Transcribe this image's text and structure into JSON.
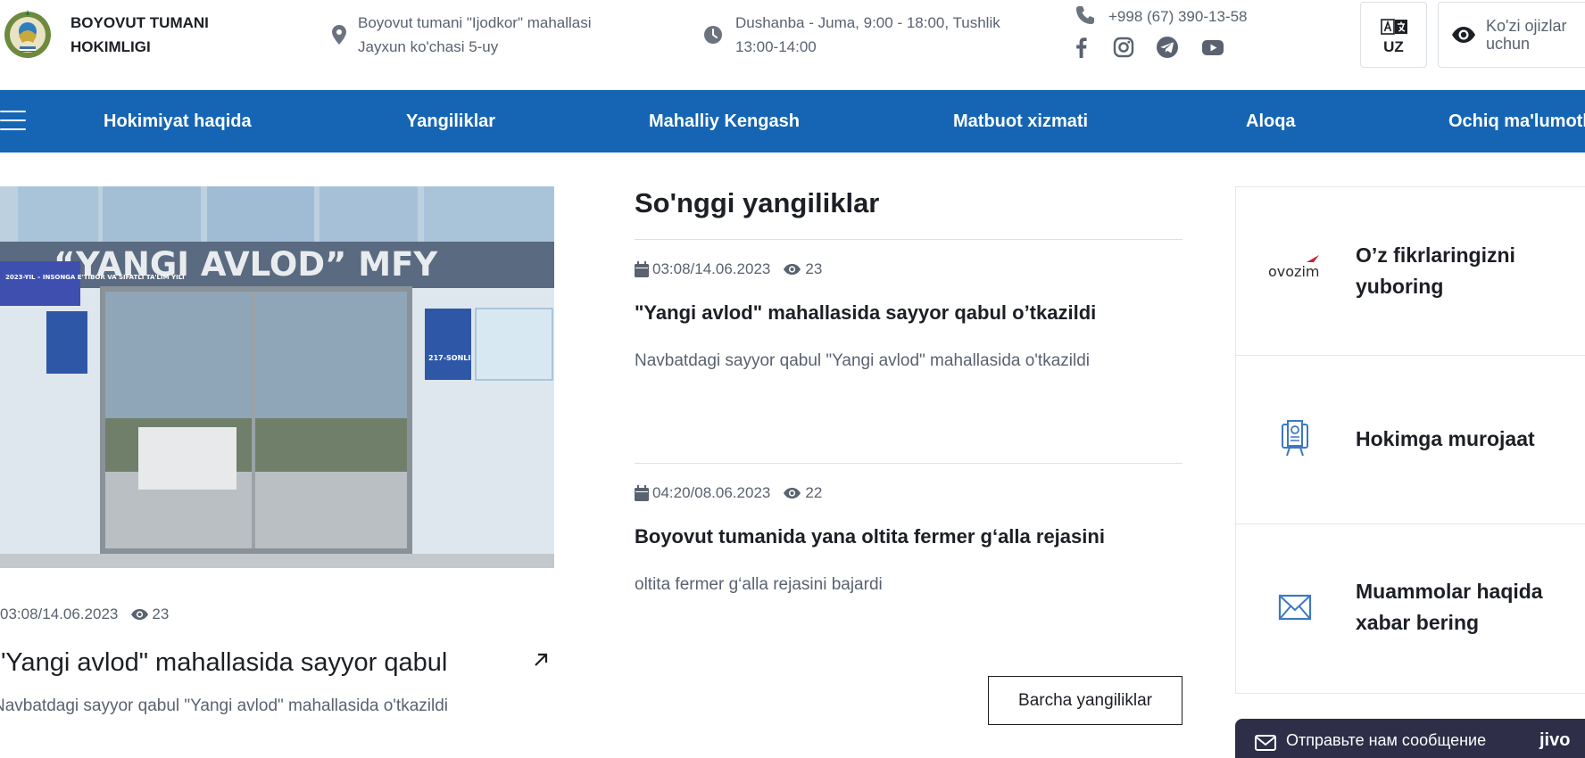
{
  "header": {
    "org_name": "BOYOVUT TUMANI HOKIMLIGI",
    "address": "Boyovut tumani \"Ijodkor\" mahallasi Jayxun ko'chasi 5-uy",
    "hours": "Dushanba - Juma, 9:00 - 18:00, Tushlik 13:00-14:00",
    "phone": "+998 (67) 390-13-58",
    "social_icons": [
      "facebook-icon",
      "instagram-icon",
      "telegram-icon",
      "youtube-icon"
    ],
    "language_label": "UZ",
    "accessibility_label": "Ko'zi ojizlar uchun"
  },
  "nav": {
    "items": [
      {
        "label": "Hokimiyat haqida"
      },
      {
        "label": "Yangiliklar"
      },
      {
        "label": "Mahalliy Kengash"
      },
      {
        "label": "Matbuot xizmati"
      },
      {
        "label": "Aloqa"
      },
      {
        "label": "Ochiq ma'lumotlar"
      }
    ]
  },
  "featured": {
    "image": {
      "sign_text": "“YANGI AVLOD” MFY",
      "banner_text": "2023-YIL – INSONGA E'TIBOR VA SIFATLI TA'LIM YILI",
      "plaque_text": "217-SONLI"
    },
    "date": "03:08/14.06.2023",
    "views": "23",
    "title": "\"Yangi avlod\" mahallasida sayyor qabul",
    "description": "Navbatdagi sayyor qabul \"Yangi avlod\" mahallasida o'tkazildi"
  },
  "latest": {
    "heading": "So'nggi yangiliklar",
    "items": [
      {
        "date": "03:08/14.06.2023",
        "views": "23",
        "title": "\"Yangi avlod\" mahallasida sayyor qabul o’tkazildi",
        "description": "Navbatdagi sayyor qabul \"Yangi avlod\" mahallasida o'tkazildi"
      },
      {
        "date": "04:20/08.06.2023",
        "views": "22",
        "title": "Boyovut tumanida yana oltita fermer g‘alla rejasini",
        "description": "oltita fermer g‘alla rejasini bajardi"
      }
    ],
    "all_button": "Barcha yangiliklar"
  },
  "services": {
    "items": [
      {
        "icon": "ovozim-logo",
        "logo_text": "ovozim",
        "label": "O’z fikrlaringizni yuboring"
      },
      {
        "icon": "appeal-icon",
        "label": "Hokimga murojaat"
      },
      {
        "icon": "envelope-icon",
        "label": "Muammolar haqida xabar bering"
      }
    ]
  },
  "jivo": {
    "text": "Отправьте нам сообщение",
    "brand": "jivo"
  },
  "colors": {
    "nav_bg": "#1565b4",
    "text_dark": "#1c1f24",
    "text_muted": "#5a6270",
    "jivo_bg": "#2e2e48"
  }
}
